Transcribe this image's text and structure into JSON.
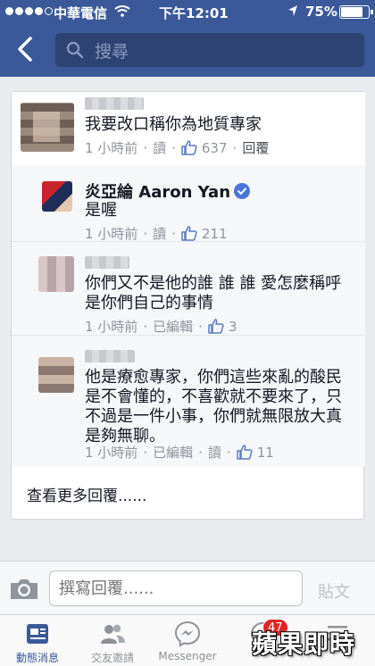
{
  "status_bar": {
    "carrier": "中華電信",
    "time": "下午12:01",
    "battery": "75%",
    "battery_level": 0.75,
    "signal_bars": 4
  },
  "nav": {
    "search_placeholder": "搜尋"
  },
  "comments": [
    {
      "author": "",
      "author_blurred": true,
      "text": "我要改口稱你為地質專家",
      "time": "1 小時前",
      "actions": [
        "讀"
      ],
      "likes": "637",
      "reply_label": "回覆"
    },
    {
      "author": "炎亞綸 Aaron Yan",
      "verified": true,
      "text": "是喔",
      "time": "1 小時前",
      "actions": [
        "讀"
      ],
      "likes": "211"
    },
    {
      "author": "",
      "author_blurred": true,
      "text_lines": [
        "你們又不是他的誰 誰 誰 愛怎麼稱呼",
        "是你們自己的事情"
      ],
      "time": "1 小時前",
      "actions": [
        "已編輯"
      ],
      "likes": "3"
    },
    {
      "author": "",
      "author_blurred": true,
      "text_lines": [
        "他是療愈專家，你們這些來亂的酸民",
        "是不會懂的，不喜歡就不要來了，只",
        "不過是一件小事，你們就無限放大真",
        "是夠無聊。"
      ],
      "time": "1 小時前",
      "actions": [
        "已編輯",
        "讀"
      ],
      "likes": "11"
    }
  ],
  "more_replies": "查看更多回覆......",
  "composer": {
    "placeholder": "撰寫回覆......",
    "post_label": "貼文"
  },
  "tabs": [
    {
      "label": "動態消息",
      "icon": "news-feed-icon",
      "active": true
    },
    {
      "label": "交友邀請",
      "icon": "friend-requests-icon"
    },
    {
      "label": "Messenger",
      "icon": "messenger-icon"
    },
    {
      "label": "",
      "icon": "notifications-icon",
      "badge": "47"
    },
    {
      "label": "",
      "icon": "more-icon"
    }
  ],
  "watermark": "蘋果即時",
  "colors": {
    "brand": "#3b5998",
    "like": "#3b5998",
    "verified": "#4a76d9",
    "badge": "#e02424"
  }
}
